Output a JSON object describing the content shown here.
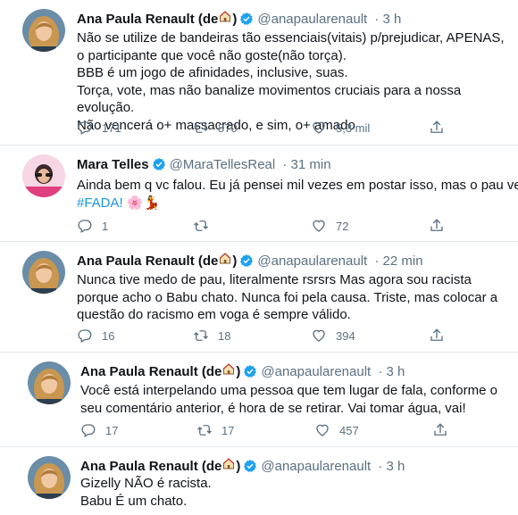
{
  "tweets": [
    {
      "name": "Ana Paula Renault (de",
      "name_suffix": ")",
      "house_icon": "house-emoji",
      "handle": "@anapaularenault",
      "time": "· 3 h",
      "text": "Não se utilize de bandeiras tão essenciais(vitais) p/prejudicar, APENAS, o participante que você não goste(não torça).\nBBB é um jogo de afinidades, inclusive, suas.\nTorça, vote, mas não banalize movimentos cruciais para a nossa evolução.\nNão vencerá o+ massacrado, e sim, o+ amado",
      "replies": "171",
      "retweets": "870",
      "likes": "5,3 mil"
    },
    {
      "name": "Mara Telles",
      "handle": "@MaraTellesReal",
      "time": "· 31 min",
      "text": "Ainda bem q vc falou. Eu já pensei mil vezes em postar isso, mas o pau vem.",
      "hashtag": "#FADA!",
      "emojis": "🌸💃",
      "replies": "1",
      "retweets": "",
      "likes": "72"
    },
    {
      "name": "Ana Paula Renault (de",
      "name_suffix": ")",
      "house_icon": "house-emoji",
      "handle": "@anapaularenault",
      "time": "· 22 min",
      "text": "Nunca tive medo de pau, literalmente rsrsrs Mas agora sou racista porque acho o Babu chato. Nunca foi pela causa. Triste, mas colocar a questão do racismo em voga é sempre válido.",
      "replies": "16",
      "retweets": "18",
      "likes": "394"
    },
    {
      "name": "Ana Paula Renault (de",
      "name_suffix": ")",
      "house_icon": "house-emoji",
      "handle": "@anapaularenault",
      "time": "· 3 h",
      "text": "Você está interpelando uma pessoa que tem lugar de fala, conforme o seu comentário anterior, é hora de se retirar. Vai tomar água, vai!",
      "replies": "17",
      "retweets": "17",
      "likes": "457"
    },
    {
      "name": "Ana Paula Renault (de",
      "name_suffix": ")",
      "house_icon": "house-emoji",
      "handle": "@anapaularenault",
      "time": "· 3 h",
      "text": "Gizelly NÃO é racista.\nBabu É um chato."
    }
  ],
  "colors": {
    "verified": "#1da1f2",
    "muted": "#5b7083",
    "hashtag": "#1b95e0",
    "divider": "#e1e8ed"
  }
}
